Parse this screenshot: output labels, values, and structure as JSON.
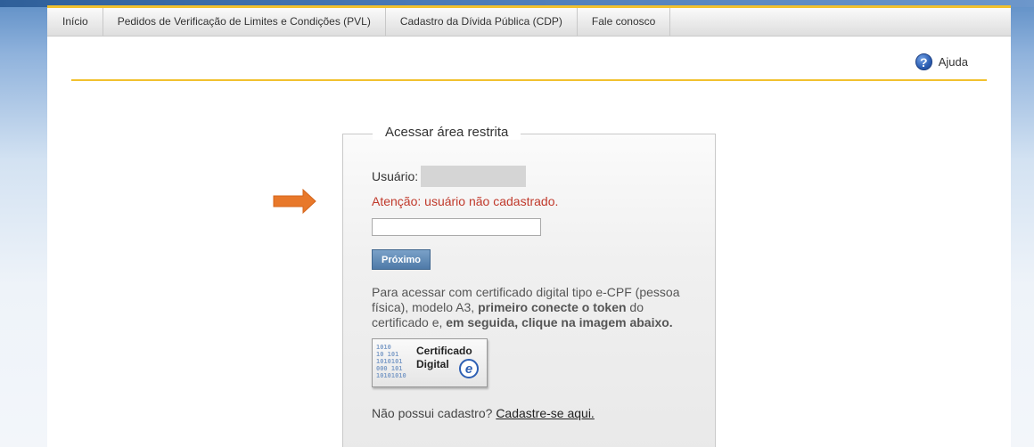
{
  "nav": {
    "items": [
      {
        "label": "Início"
      },
      {
        "label": "Pedidos de Verificação de Limites e Condições (PVL)"
      },
      {
        "label": "Cadastro da Dívida Pública (CDP)"
      },
      {
        "label": "Fale conosco"
      }
    ]
  },
  "help": {
    "label": "Ajuda",
    "icon": "help-icon",
    "glyph": "?"
  },
  "login": {
    "legend": "Acessar área restrita",
    "user_label": "Usuário:",
    "error_message": "Atenção: usuário não cadastrado.",
    "input_value": "",
    "next_button": "Próximo",
    "cert_prefix": "Para acessar com certificado digital tipo e-CPF (pessoa física), modelo A3, ",
    "cert_bold_1": "primeiro conecte o token",
    "cert_mid": " do certificado e, ",
    "cert_bold_2": "em seguida, clique na imagem abaixo.",
    "cert_image": {
      "line1": "Certificado",
      "line2": "Digital",
      "badge": "e"
    },
    "signup_text": "Não possui cadastro?",
    "signup_link": "Cadastre-se aqui."
  },
  "colors": {
    "accent_yellow": "#f2c12e",
    "error_red": "#c0392b",
    "button_blue": "#4f7aa8",
    "arrow_orange": "#e8782a"
  }
}
